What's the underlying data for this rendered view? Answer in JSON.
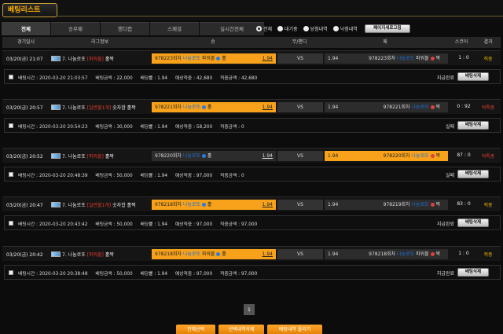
{
  "title": "베팅리스트",
  "tabs": [
    "전체",
    "승무패",
    "핸디캡",
    "스페셜",
    "실시간전체"
  ],
  "filters": [
    {
      "label": "전체",
      "selected": true
    },
    {
      "label": "대기중",
      "selected": false
    },
    {
      "label": "당첨내역",
      "selected": false
    },
    {
      "label": "낙첨내역",
      "selected": false
    }
  ],
  "refresh_button": "페이지새로고침",
  "headers": [
    "경기일시",
    "리그정보",
    "승",
    "무/핸디",
    "패",
    "스코어",
    "결과"
  ],
  "bets": [
    {
      "date": "03/20(금) 21:07",
      "league_name": "7. 나눔로또",
      "league_tag": "[파워볼]",
      "league_suffix": "홀짝",
      "home_prefix": "978223회차",
      "home_team": "나눔로또",
      "home_tail": "파워볼",
      "home_pick": "홀",
      "home_odds": "1.94",
      "vs": "VS",
      "away_odds": "1.94",
      "away_prefix": "978223회차",
      "away_team": "나눔로또",
      "away_tail": "파워볼",
      "away_pick": "짝",
      "score": "1 : 0",
      "result": "적중",
      "result_kind": "win",
      "picked": "home",
      "bet_time": "배팅시간 : 2020-03-20 21:03:57",
      "bet_amount": "배팅금액 : 22,000",
      "odds_total": "배당률 : 1.94",
      "expected": "예상적중 : 42,680",
      "hit_amount": "적중금액 : 42,680",
      "status": "지급완료",
      "delete": "배팅삭제"
    },
    {
      "date": "03/20(금) 20:57",
      "league_name": "7. 나눔로또",
      "league_tag": "[일반볼1개]",
      "league_suffix": "숫자합 홀짝",
      "home_prefix": "978221회차",
      "home_team": "나눔로또",
      "home_tail": "",
      "home_pick": "홀",
      "home_odds": "1.94",
      "vs": "VS",
      "away_odds": "1.94",
      "away_prefix": "978221회차",
      "away_team": "나눔로또",
      "away_tail": "",
      "away_pick": "짝",
      "score": "0 : 92",
      "result": "적특중",
      "result_kind": "lose",
      "picked": "home",
      "bet_time": "배팅시간 : 2020-03-20 20:54:23",
      "bet_amount": "배팅금액 : 30,000",
      "odds_total": "배당률 : 1.94",
      "expected": "예상적중 : 58,200",
      "hit_amount": "적중금액 : 0",
      "status": "실패",
      "delete": "배팅삭제"
    },
    {
      "date": "03/20(금) 20:52",
      "league_name": "7. 나눔로또",
      "league_tag": "[파워볼]",
      "league_suffix": "홀짝",
      "home_prefix": "978220회차",
      "home_team": "나눔로또",
      "home_tail": "",
      "home_pick": "홀",
      "home_odds": "1.94",
      "vs": "VS",
      "away_odds": "1.94",
      "away_prefix": "978220회차",
      "away_team": "나눔로또",
      "away_tail": "",
      "away_pick": "짝",
      "score": "87 : 0",
      "result": "적특중",
      "result_kind": "lose",
      "picked": "away",
      "bet_time": "배팅시간 : 2020-03-20 20:48:39",
      "bet_amount": "배팅금액 : 50,000",
      "odds_total": "배당률 : 1.94",
      "expected": "예상적중 : 97,000",
      "hit_amount": "적중금액 : 0",
      "status": "실패",
      "delete": "배팅삭제"
    },
    {
      "date": "03/20(금) 20:47",
      "league_name": "7. 나눔로또",
      "league_tag": "[일반볼1개]",
      "league_suffix": "숫자합 홀짝",
      "home_prefix": "978218회차",
      "home_team": "나눔로또",
      "home_tail": "",
      "home_pick": "홀",
      "home_odds": "1.94",
      "vs": "VS",
      "away_odds": "1.94",
      "away_prefix": "978219회차",
      "away_team": "나눔로또",
      "away_tail": "",
      "away_pick": "짝",
      "score": "83 : 0",
      "result": "적중",
      "result_kind": "win",
      "picked": "home",
      "bet_time": "배팅시간 : 2020-03-20 20:43:42",
      "bet_amount": "배팅금액 : 50,000",
      "odds_total": "배당률 : 1.94",
      "expected": "예상적중 : 97,000",
      "hit_amount": "적중금액 : 97,000",
      "status": "지급완료",
      "delete": "배팅삭제"
    },
    {
      "date": "03/20(금) 20:42",
      "league_name": "7. 나눔로또",
      "league_tag": "[파워볼]",
      "league_suffix": "홀짝",
      "home_prefix": "978218회차",
      "home_team": "나눔로또",
      "home_tail": "파워볼",
      "home_pick": "홀",
      "home_odds": "1.94",
      "vs": "VS",
      "away_odds": "1.94",
      "away_prefix": "978218회차",
      "away_team": "나눔로또",
      "away_tail": "파워볼",
      "away_pick": "짝",
      "score": "1 : 0",
      "result": "적중",
      "result_kind": "win",
      "picked": "home",
      "bet_time": "배팅시간 : 2020-03-20 20:38:48",
      "bet_amount": "배팅금액 : 50,000",
      "odds_total": "배당률 : 1.94",
      "expected": "예상적중 : 97,000",
      "hit_amount": "적중금액 : 97,000",
      "status": "지급완료",
      "delete": "배팅삭제"
    }
  ],
  "pagination": {
    "current": "1"
  },
  "bottom_buttons": [
    "전체선택",
    "선택내역삭제",
    "배팅내역 올리기"
  ]
}
